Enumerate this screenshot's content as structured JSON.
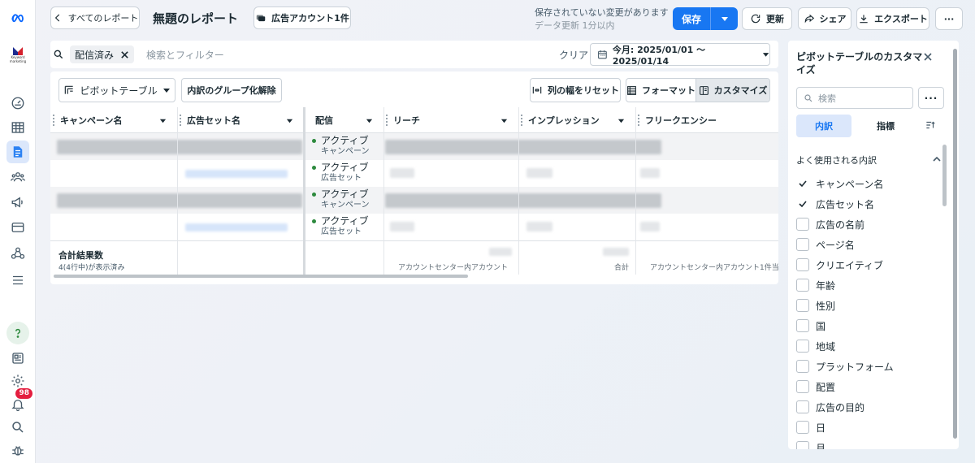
{
  "header": {
    "back_label": "すべてのレポート",
    "title": "無題のレポート",
    "account_label": "広告アカウント1件",
    "unsaved_text": "保存されていない変更があります",
    "updated_text": "データ更新 1分以内",
    "save_label": "保存",
    "refresh_label": "更新",
    "share_label": "シェア",
    "export_label": "エクスポート",
    "more_label": "···"
  },
  "search": {
    "chip_label": "配信済み",
    "placeholder": "検索とフィルター",
    "clear_label": "クリア",
    "date_label": "今月: 2025/01/01 ～ 2025/01/14"
  },
  "toolbar": {
    "pivot_label": "ピボットテーブル",
    "ungroup_label": "内訳のグループ化解除",
    "reset_width_label": "列の幅をリセット",
    "format_label": "フォーマット",
    "customize_label": "カスタマイズ"
  },
  "table": {
    "columns": [
      "キャンペーン名",
      "広告セット名",
      "配信",
      "リーチ",
      "インプレッション",
      "フリークエンシー"
    ],
    "rows": [
      {
        "status": "アクティブ",
        "level": "キャンペーン"
      },
      {
        "status": "アクティブ",
        "level": "広告セット"
      },
      {
        "status": "アクティブ",
        "level": "キャンペーン"
      },
      {
        "status": "アクティブ",
        "level": "広告セット"
      }
    ],
    "totals": {
      "label": "合計結果数",
      "sub": "4(4行中)が表示済み",
      "reach_note": "アカウントセンター内アカウント",
      "impr_note": "合計",
      "freq_note": "アカウントセンター内アカウント1件当"
    }
  },
  "side_panel": {
    "title": "ピボットテーブルのカスタマイズ",
    "search_placeholder": "検索",
    "more_label": "···",
    "tabs": [
      "内訳",
      "指標"
    ],
    "section_label": "よく使用される内訳",
    "items": [
      {
        "label": "キャンペーン名",
        "checked": true
      },
      {
        "label": "広告セット名",
        "checked": true
      },
      {
        "label": "広告の名前",
        "checked": false
      },
      {
        "label": "ページ名",
        "checked": false
      },
      {
        "label": "クリエイティブ",
        "checked": false
      },
      {
        "label": "年齢",
        "checked": false
      },
      {
        "label": "性別",
        "checked": false
      },
      {
        "label": "国",
        "checked": false
      },
      {
        "label": "地域",
        "checked": false
      },
      {
        "label": "プラットフォーム",
        "checked": false
      },
      {
        "label": "配置",
        "checked": false
      },
      {
        "label": "広告の目的",
        "checked": false
      },
      {
        "label": "日",
        "checked": false
      },
      {
        "label": "月",
        "checked": false
      }
    ]
  },
  "nav": {
    "notification_count": "98"
  },
  "colors": {
    "accent": "#1877f2",
    "active_dot": "#2d8a3e",
    "badge": "#e41e3f"
  }
}
